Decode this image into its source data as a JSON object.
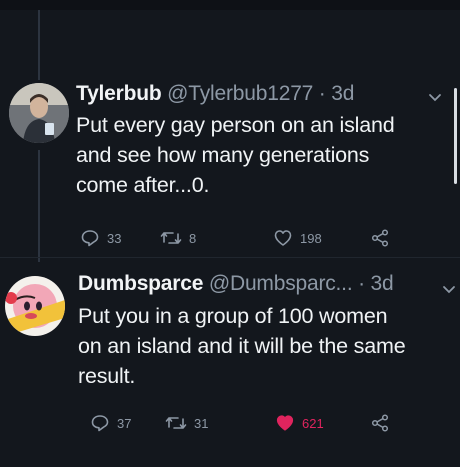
{
  "tweets": [
    {
      "name": "Tylerbub",
      "handle": "@Tylerbub1277",
      "dot": "·",
      "time": "3d",
      "text_lines": [
        "Put every gay person on an island",
        "and see how many generations",
        "come after...0."
      ],
      "reply_count": "33",
      "retweet_count": "8",
      "like_count": "198",
      "liked": false
    },
    {
      "name": "Dumbsparce",
      "handle": "@Dumbsparc...",
      "dot": "·",
      "time": "3d",
      "text_lines": [
        "Put you in a group of 100 women",
        "on an island and it will be the same",
        "result."
      ],
      "reply_count": "37",
      "retweet_count": "31",
      "like_count": "621",
      "liked": true
    }
  ],
  "colors": {
    "background": "#13171d",
    "secondary_text": "#8d98a5",
    "like_red": "#e0245e"
  },
  "icons": [
    "reply-icon",
    "retweet-icon",
    "like-icon",
    "share-icon",
    "chevron-down-icon"
  ]
}
